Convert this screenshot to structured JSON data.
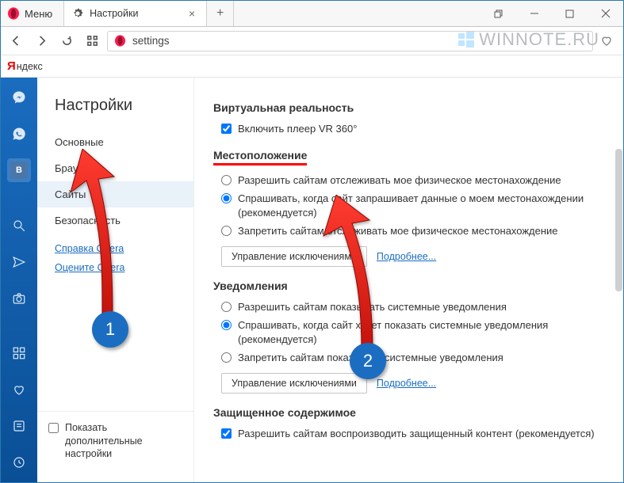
{
  "titlebar": {
    "menu_label": "Меню",
    "tab_label": "Настройки"
  },
  "addr": {
    "value": "settings"
  },
  "watermark": "WINNOTE.RU",
  "searchbar": {
    "provider": "ндекс"
  },
  "sidebar": {
    "title": "Настройки",
    "items": [
      {
        "label": "Основные"
      },
      {
        "label": "Браузер"
      },
      {
        "label": "Сайты"
      },
      {
        "label": "Безопасность"
      }
    ],
    "links": [
      {
        "label": "Справка Opera"
      },
      {
        "label": "Оцените Opera"
      }
    ],
    "advanced_label": "Показать дополнительные настройки"
  },
  "vr": {
    "title": "Виртуальная реальность",
    "enable_label": "Включить плеер VR 360°"
  },
  "location": {
    "title": "Местоположение",
    "options": [
      "Разрешить сайтам отслеживать мое физическое местонахождение",
      "Спрашивать, когда сайт запрашивает данные о моем местонахождении (рекомендуется)",
      "Запретить сайтам отслеживать мое физическое местонахождение"
    ],
    "manage_btn": "Управление исключениями",
    "more_link": "Подробнее..."
  },
  "notifications": {
    "title": "Уведомления",
    "options": [
      "Разрешить сайтам показывать системные уведомления",
      "Спрашивать, когда сайт хочет показать системные уведомления (рекомендуется)",
      "Запретить сайтам показывать системные уведомления"
    ],
    "manage_btn": "Управление исключениями",
    "more_link": "Подробнее..."
  },
  "protected": {
    "title": "Защищенное содержимое",
    "enable_label": "Разрешить сайтам воспроизводить защищенный контент (рекомендуется)"
  },
  "annotations": {
    "badge1": "1",
    "badge2": "2"
  }
}
